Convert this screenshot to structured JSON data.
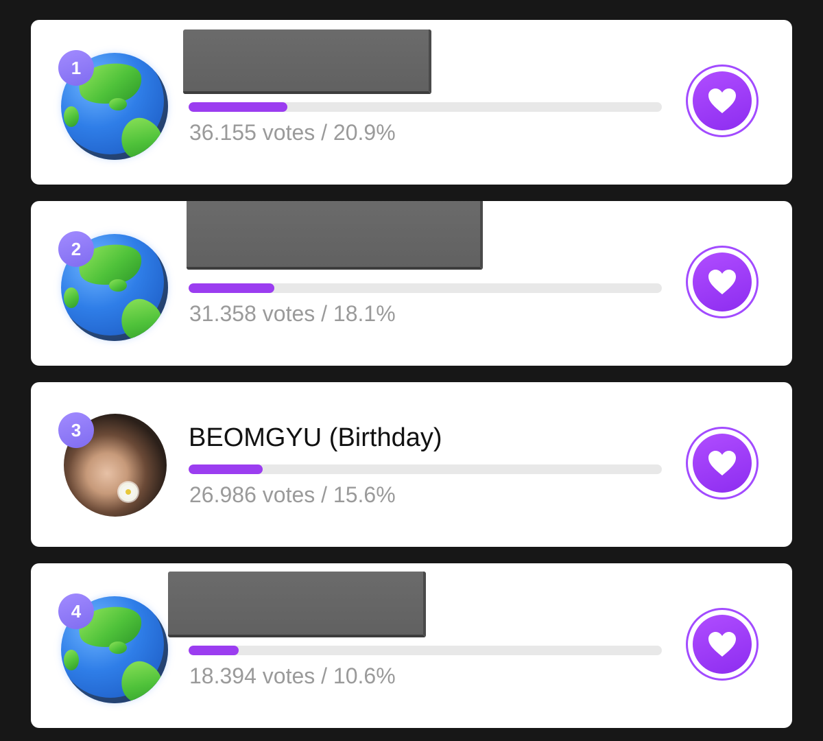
{
  "colors": {
    "background": "#171717",
    "card": "#ffffff",
    "accent": "#9b3df0",
    "rank_badge": "#8f7bf5",
    "votes_text": "#9a9a9a"
  },
  "entries": [
    {
      "rank": "1",
      "name": "",
      "avatar_icon": "globe-icon",
      "name_censored": true,
      "votes_text": "36.155 votes / 20.9%",
      "percent": 20.9,
      "vote_button_icon": "heart-icon"
    },
    {
      "rank": "2",
      "name": "",
      "avatar_icon": "globe-icon",
      "name_censored": true,
      "votes_text": "31.358 votes / 18.1%",
      "percent": 18.1,
      "vote_button_icon": "heart-icon"
    },
    {
      "rank": "3",
      "name": "BEOMGYU (Birthday)",
      "avatar_icon": "profile-photo",
      "name_censored": false,
      "votes_text": "26.986 votes / 15.6%",
      "percent": 15.6,
      "vote_button_icon": "heart-icon"
    },
    {
      "rank": "4",
      "name": "",
      "avatar_icon": "globe-icon",
      "name_censored": true,
      "votes_text": "18.394 votes / 10.6%",
      "percent": 10.6,
      "vote_button_icon": "heart-icon"
    }
  ]
}
